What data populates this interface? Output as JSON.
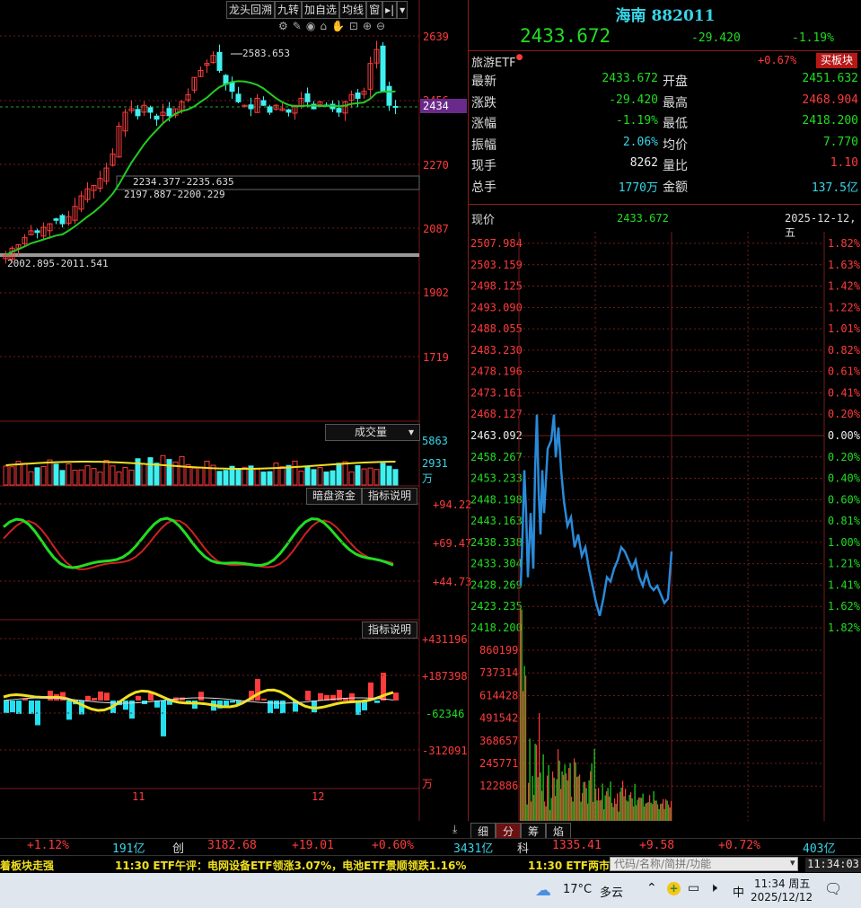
{
  "toolbar": {
    "buttons": [
      "龙头回溯",
      "九转",
      "加自选",
      "均线",
      "窗"
    ],
    "arrow_label": "▸|",
    "dropdown_label": "▾"
  },
  "kline": {
    "price_axis": [
      "2639",
      "2456",
      "2434",
      "2270",
      "2087",
      "1902",
      "1719"
    ],
    "current_tag": "2434",
    "annotations": [
      "2583.653",
      "2234.377-2235.635",
      "2197.887-2200.229",
      "2002.895-2011.541"
    ]
  },
  "volume": {
    "selector": "成交量",
    "axis": [
      "5863",
      "2931",
      "万"
    ]
  },
  "indicator1": {
    "buttons": [
      "暗盘资金",
      "指标说明"
    ],
    "axis": [
      "+94.22",
      "+69.47",
      "+44.73"
    ]
  },
  "indicator2": {
    "button": "指标说明",
    "axis": [
      "+431196",
      "+187398",
      "-62346",
      "-312091",
      "万"
    ]
  },
  "xaxis": {
    "labels": [
      "11",
      "12"
    ]
  },
  "header": {
    "name": "海南",
    "code": "882011",
    "price": "2433.672",
    "change": "-29.420",
    "change_pct": "-1.19%",
    "etf_label": "旅游ETF",
    "etf_pct": "+0.67%",
    "buy_button": "买板块"
  },
  "metrics": [
    {
      "l1": "最新",
      "v1": "2433.672",
      "c1": "green",
      "l2": "开盘",
      "v2": "2451.632",
      "c2": "green"
    },
    {
      "l1": "涨跌",
      "v1": "-29.420",
      "c1": "green",
      "l2": "最高",
      "v2": "2468.904",
      "c2": "red"
    },
    {
      "l1": "涨幅",
      "v1": "-1.19%",
      "c1": "green",
      "l2": "最低",
      "v2": "2418.200",
      "c2": "green"
    },
    {
      "l1": "振幅",
      "v1": "2.06%",
      "c1": "cyan",
      "l2": "均价",
      "v2": "7.770",
      "c2": "green"
    },
    {
      "l1": "现手",
      "v1": "8262",
      "c1": "white",
      "l2": "量比",
      "v2": "1.10",
      "c2": "red"
    },
    {
      "l1": "总手",
      "v1": "1770万",
      "c1": "cyan",
      "l2": "金额",
      "v2": "137.5亿",
      "c2": "cyan"
    }
  ],
  "intraday": {
    "label": "现价",
    "price": "2433.672",
    "date": "2025-12-12,五",
    "price_axis": [
      "2507.984",
      "2503.159",
      "2498.125",
      "2493.090",
      "2488.055",
      "2483.230",
      "2478.196",
      "2473.161",
      "2468.127",
      "2463.092",
      "2458.267",
      "2453.233",
      "2448.198",
      "2443.163",
      "2438.338",
      "2433.304",
      "2428.269",
      "2423.235",
      "2418.200"
    ],
    "pct_axis": [
      "1.82%",
      "1.63%",
      "1.42%",
      "1.22%",
      "1.01%",
      "0.82%",
      "0.61%",
      "0.41%",
      "0.20%",
      "0.00%",
      "0.20%",
      "0.40%",
      "0.60%",
      "0.81%",
      "1.00%",
      "1.21%",
      "1.41%",
      "1.62%",
      "1.82%"
    ],
    "vol_axis": [
      "860199",
      "737314",
      "614428",
      "491542",
      "368657",
      "245771",
      "122886"
    ],
    "tabs": [
      "细",
      "分",
      "筹",
      "焰"
    ]
  },
  "ticker1": {
    "items": [
      "+1.12%",
      "191亿",
      "创",
      "3182.68",
      "+19.01",
      "+0.60%",
      "3431亿",
      "科",
      "1335.41",
      "+9.58",
      "+0.72%",
      "403亿"
    ]
  },
  "ticker2": {
    "left_text": "着板块走强",
    "news": "11:30 ETF午评：电网设备ETF领涨3.07%，电池ETF景顺领跌1.16%",
    "news2": "11:30 ETF两市",
    "search_placeholder": "代码/名称/简拼/功能",
    "clock": "11:34:03"
  },
  "taskbar": {
    "temp": "17°C",
    "weather": "多云",
    "ime": "中",
    "time": "11:34 周五",
    "date": "2025/12/12"
  },
  "colors": {
    "up": "#ff3b3b",
    "down": "#3ff0f0",
    "ma": "#22cc22",
    "grid": "#7a1a1a"
  }
}
